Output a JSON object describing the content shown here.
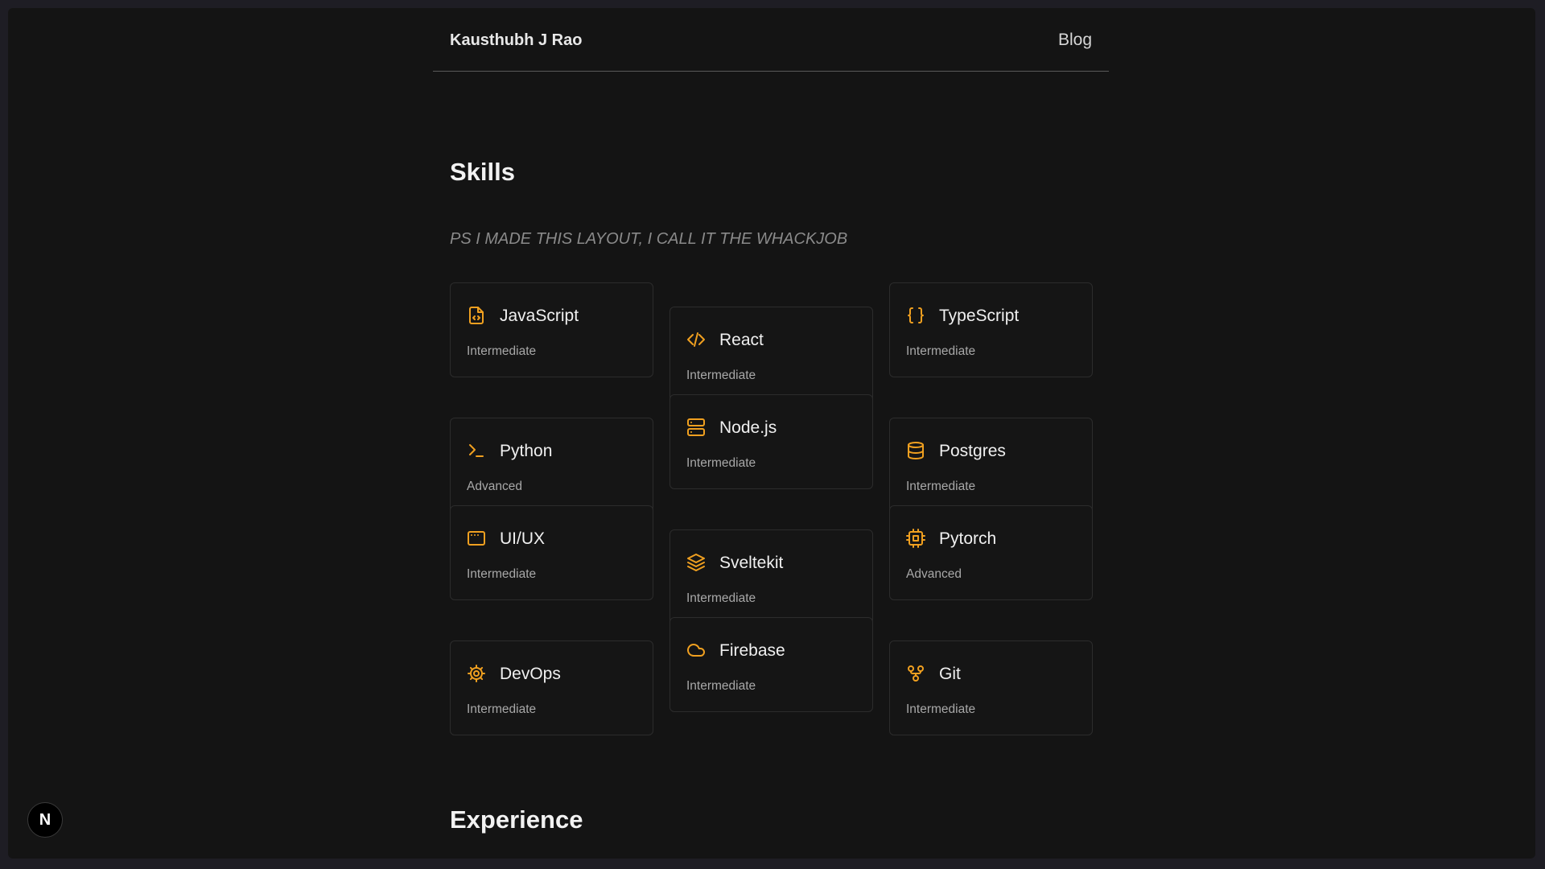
{
  "header": {
    "brand": "Kausthubh J Rao",
    "blog_label": "Blog"
  },
  "skills": {
    "title": "Skills",
    "subtitle": "PS I MADE THIS LAYOUT, I CALL IT THE WHACKJOB",
    "items": [
      {
        "name": "JavaScript",
        "level": "Intermediate",
        "icon": "file-code-icon"
      },
      {
        "name": "React",
        "level": "Intermediate",
        "icon": "code-icon"
      },
      {
        "name": "TypeScript",
        "level": "Intermediate",
        "icon": "braces-icon"
      },
      {
        "name": "Python",
        "level": "Advanced",
        "icon": "terminal-icon"
      },
      {
        "name": "Node.js",
        "level": "Intermediate",
        "icon": "server-icon"
      },
      {
        "name": "Postgres",
        "level": "Intermediate",
        "icon": "database-icon"
      },
      {
        "name": "UI/UX",
        "level": "Intermediate",
        "icon": "app-window-icon"
      },
      {
        "name": "Sveltekit",
        "level": "Intermediate",
        "icon": "layers-icon"
      },
      {
        "name": "Pytorch",
        "level": "Advanced",
        "icon": "cpu-icon"
      },
      {
        "name": "DevOps",
        "level": "Intermediate",
        "icon": "cog-icon"
      },
      {
        "name": "Firebase",
        "level": "Intermediate",
        "icon": "cloud-icon"
      },
      {
        "name": "Git",
        "level": "Intermediate",
        "icon": "git-fork-icon"
      }
    ]
  },
  "experience": {
    "title": "Experience"
  },
  "dev_badge": {
    "label": "N",
    "icon": "nextjs-icon"
  },
  "colors": {
    "accent": "#f0a020",
    "background": "#141414",
    "card_border": "#2c2c2c"
  }
}
